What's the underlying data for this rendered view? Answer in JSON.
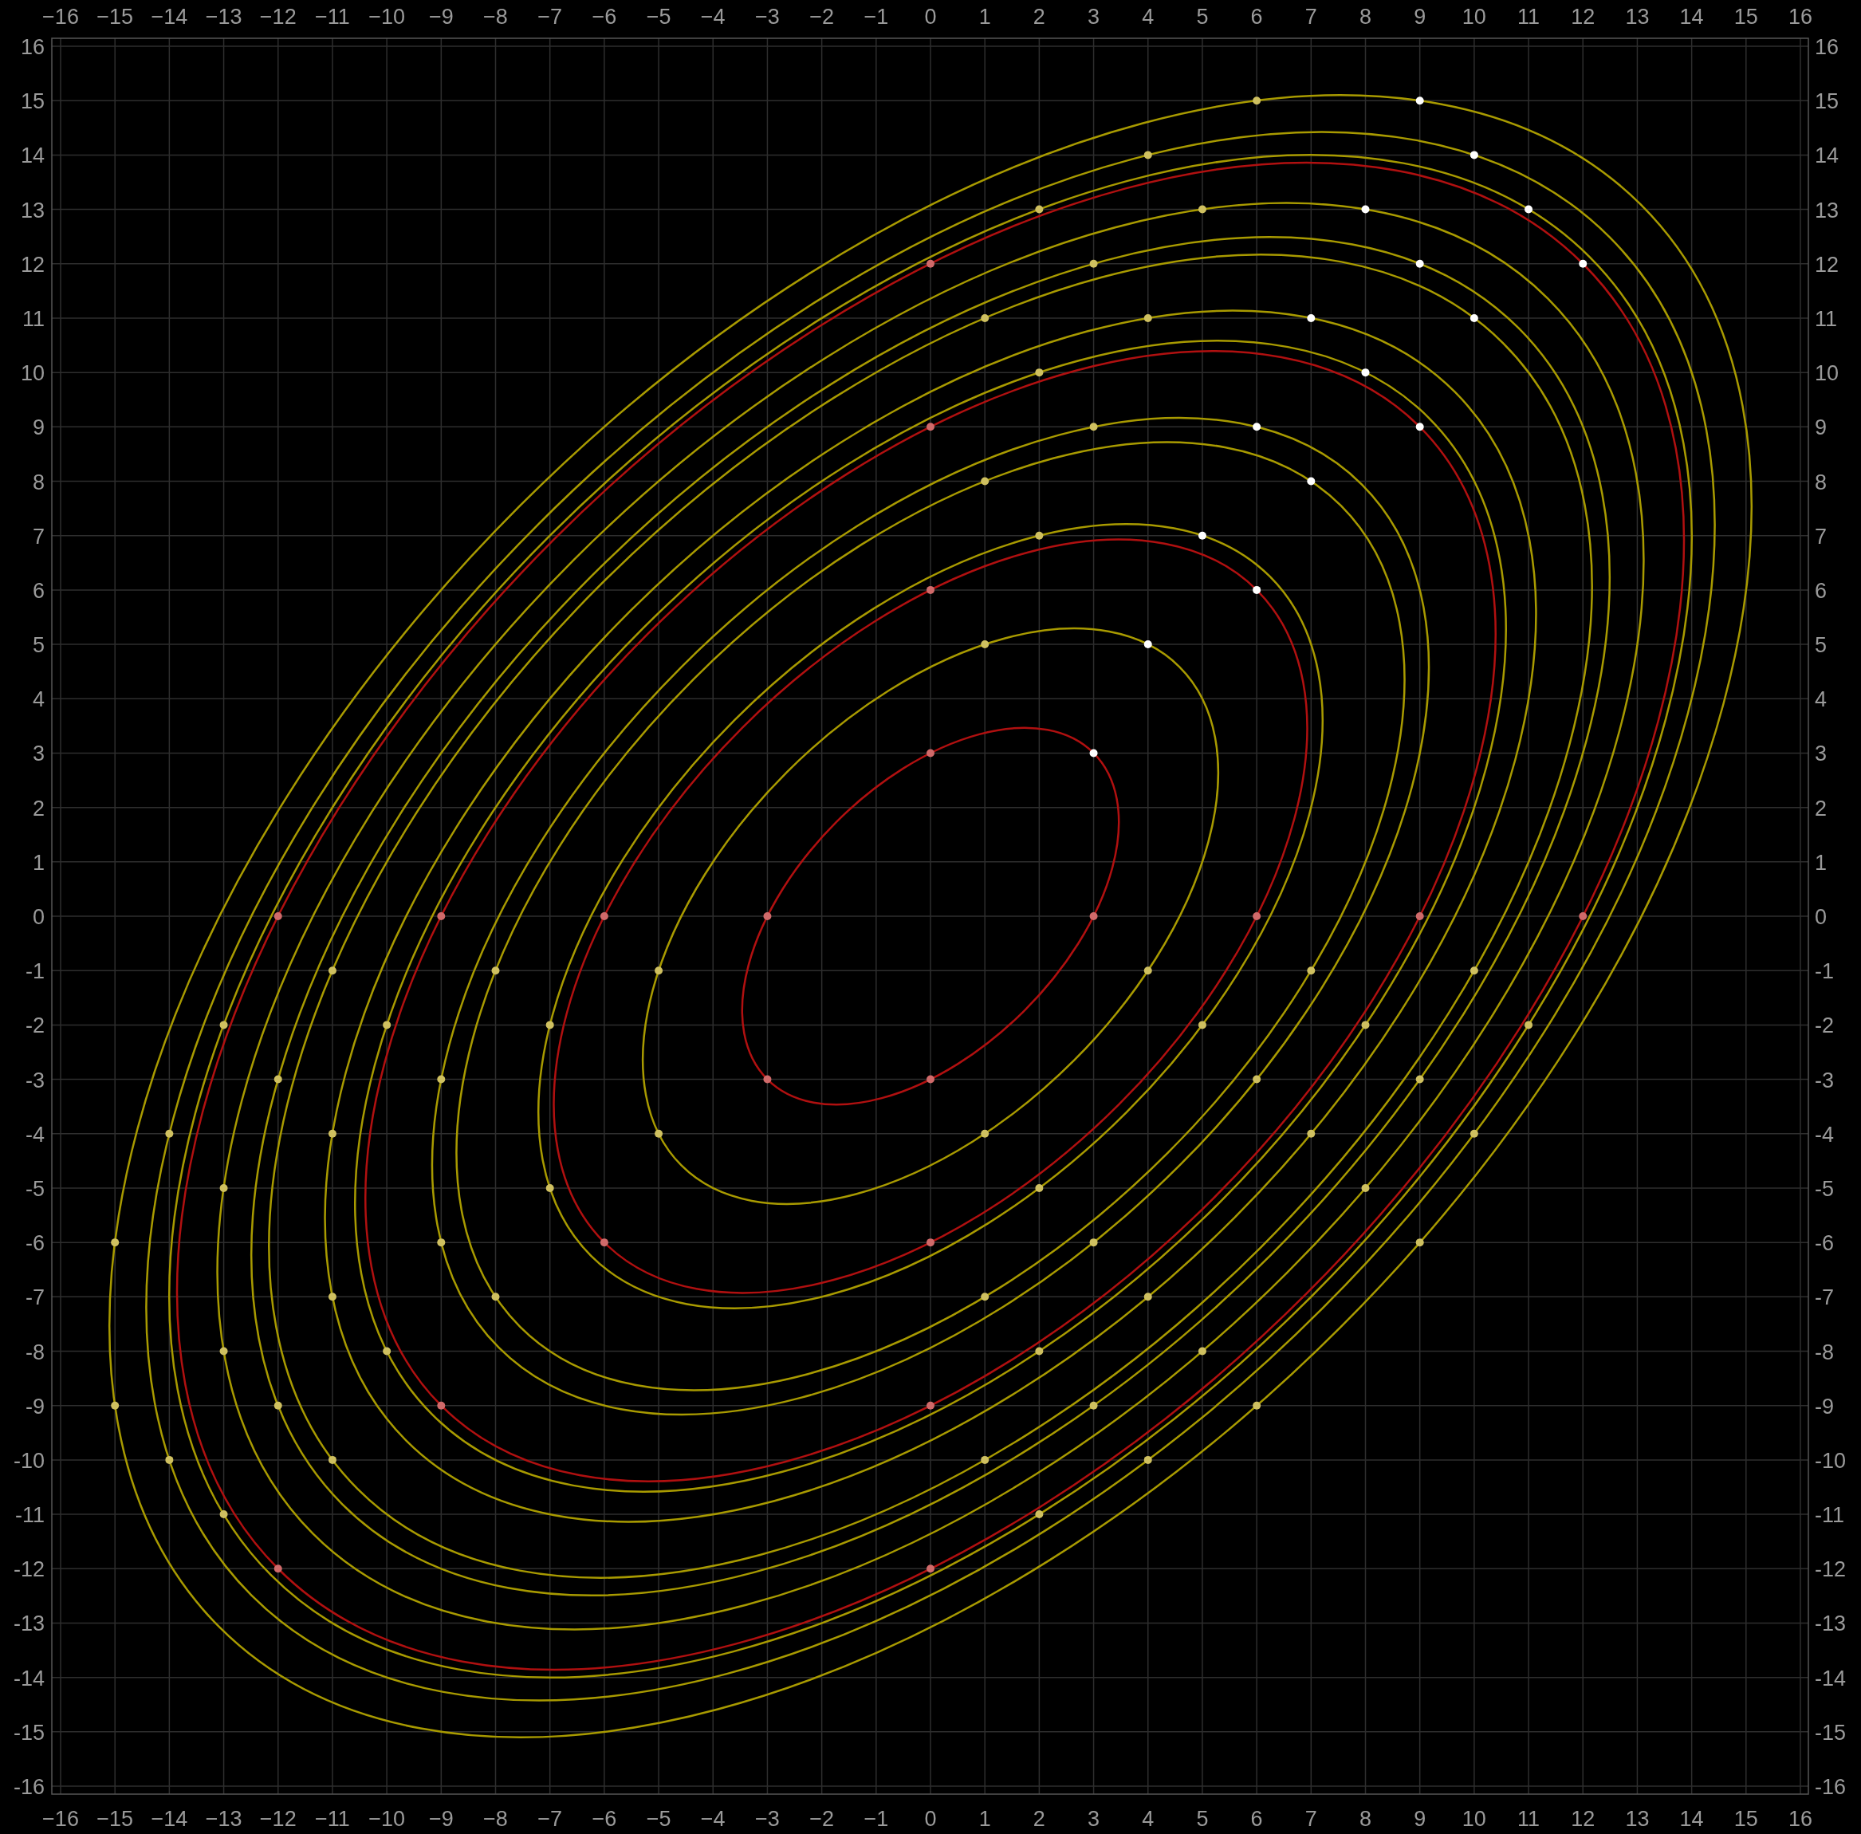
{
  "top_axis_labels": [
    "−16",
    "−15",
    "−14",
    "−13",
    "−12",
    "−11",
    "−10",
    "−9",
    "−8",
    "−7",
    "−6",
    "−5",
    "−4",
    "−3",
    "−2",
    "−1",
    "0",
    "1",
    "2",
    "3",
    "4",
    "5",
    "6",
    "7",
    "8",
    "9",
    "10",
    "11",
    "12",
    "13",
    "14",
    "15",
    "16"
  ],
  "right_axis_labels": [
    "16",
    "15",
    "14",
    "13",
    "12",
    "11",
    "10",
    "9",
    "8",
    "7",
    "6",
    "5",
    "4",
    "3",
    "2",
    "1",
    "0",
    "-1",
    "-2",
    "-3",
    "-4",
    "-5",
    "-6",
    "-7",
    "-8",
    "-9",
    "-10",
    "-11",
    "-12",
    "-13",
    "-14",
    "-15",
    "-16"
  ],
  "chart_data": {
    "type": "scatter",
    "grid": true,
    "xlim": [
      -16,
      16
    ],
    "ylim": [
      -16,
      16
    ],
    "xticks": [
      {
        "value": -16,
        "label": "−16"
      },
      {
        "value": -15,
        "label": "−15"
      },
      {
        "value": -14,
        "label": "−14"
      },
      {
        "value": -13,
        "label": "−13"
      },
      {
        "value": -12,
        "label": "−12"
      },
      {
        "value": -11,
        "label": "−11"
      },
      {
        "value": -10,
        "label": "−10"
      },
      {
        "value": -9,
        "label": "−9"
      },
      {
        "value": -8,
        "label": "−8"
      },
      {
        "value": -7,
        "label": "−7"
      },
      {
        "value": -6,
        "label": "−6"
      },
      {
        "value": -5,
        "label": "−5"
      },
      {
        "value": -4,
        "label": "−4"
      },
      {
        "value": -3,
        "label": "−3"
      },
      {
        "value": -2,
        "label": "−2"
      },
      {
        "value": -1,
        "label": "−1"
      },
      {
        "value": 0,
        "label": "0"
      },
      {
        "value": 1,
        "label": "1"
      },
      {
        "value": 2,
        "label": "2"
      },
      {
        "value": 3,
        "label": "3"
      },
      {
        "value": 4,
        "label": "4"
      },
      {
        "value": 5,
        "label": "5"
      },
      {
        "value": 6,
        "label": "6"
      },
      {
        "value": 7,
        "label": "7"
      },
      {
        "value": 8,
        "label": "8"
      },
      {
        "value": 9,
        "label": "9"
      },
      {
        "value": 10,
        "label": "10"
      },
      {
        "value": 11,
        "label": "11"
      },
      {
        "value": 12,
        "label": "12"
      },
      {
        "value": 13,
        "label": "13"
      },
      {
        "value": 14,
        "label": "14"
      },
      {
        "value": 15,
        "label": "15"
      },
      {
        "value": 16,
        "label": "16"
      }
    ],
    "yticks": [
      {
        "value": -16,
        "label": "-16"
      },
      {
        "value": -15,
        "label": "-15"
      },
      {
        "value": -14,
        "label": "-14"
      },
      {
        "value": -13,
        "label": "-13"
      },
      {
        "value": -12,
        "label": "-12"
      },
      {
        "value": -11,
        "label": "-11"
      },
      {
        "value": -10,
        "label": "-10"
      },
      {
        "value": -9,
        "label": "-9"
      },
      {
        "value": -8,
        "label": "-8"
      },
      {
        "value": -7,
        "label": "-7"
      },
      {
        "value": -6,
        "label": "-6"
      },
      {
        "value": -5,
        "label": "-5"
      },
      {
        "value": -4,
        "label": "-4"
      },
      {
        "value": -3,
        "label": "-3"
      },
      {
        "value": -2,
        "label": "-2"
      },
      {
        "value": -1,
        "label": "-1"
      },
      {
        "value": 0,
        "label": "0"
      },
      {
        "value": 1,
        "label": "1"
      },
      {
        "value": 2,
        "label": "2"
      },
      {
        "value": 3,
        "label": "3"
      },
      {
        "value": 4,
        "label": "4"
      },
      {
        "value": 5,
        "label": "5"
      },
      {
        "value": 6,
        "label": "6"
      },
      {
        "value": 7,
        "label": "7"
      },
      {
        "value": 8,
        "label": "8"
      },
      {
        "value": 9,
        "label": "9"
      },
      {
        "value": 10,
        "label": "10"
      },
      {
        "value": 11,
        "label": "11"
      },
      {
        "value": 12,
        "label": "12"
      },
      {
        "value": 13,
        "label": "13"
      },
      {
        "value": 14,
        "label": "14"
      },
      {
        "value": 15,
        "label": "15"
      },
      {
        "value": 16,
        "label": "16"
      }
    ],
    "x": [
      0,
      0,
      0,
      0,
      -12,
      -9,
      -6,
      -3,
      3,
      6,
      9,
      12,
      -3,
      0,
      -6,
      0,
      -9,
      0,
      -12,
      0,
      6,
      4,
      2,
      5,
      3,
      1,
      4,
      2,
      3,
      1,
      2,
      1,
      -11,
      -8,
      -5,
      4,
      7,
      10,
      -13,
      -10,
      -7,
      5,
      8,
      11,
      -12,
      -9,
      6,
      9,
      -14,
      -11,
      -5,
      1,
      7,
      10,
      -13,
      -7,
      2,
      8,
      -15,
      -9,
      3,
      9,
      -11,
      -8,
      1,
      4,
      -13,
      -10,
      2,
      5,
      -15,
      -12,
      3,
      6,
      -14,
      -11,
      1,
      4,
      -13,
      2,
      3,
      4,
      6,
      5,
      7,
      6,
      9,
      8,
      7,
      10,
      9,
      12,
      8,
      11,
      10,
      9
    ],
    "series": [
      {
        "color": "#d06a6a",
        "values": [
          3,
          6,
          9,
          12,
          0,
          0,
          0,
          0,
          0,
          0,
          0,
          0,
          -3,
          -3,
          -6,
          -6,
          -9,
          -9,
          -12,
          -12,
          null,
          null,
          null,
          null,
          null,
          null,
          null,
          null,
          null,
          null,
          null,
          null,
          null,
          null,
          null,
          null,
          null,
          null,
          null,
          null,
          null,
          null,
          null,
          null,
          null,
          null,
          null,
          null,
          null,
          null,
          null,
          null,
          null,
          null,
          null,
          null,
          null,
          null,
          null,
          null,
          null,
          null,
          null,
          null,
          null,
          null,
          null,
          null,
          null,
          null,
          null,
          null,
          null,
          null,
          null,
          null,
          null,
          null,
          null,
          null,
          null,
          null,
          null,
          null,
          null,
          null,
          null,
          null,
          null,
          null,
          null,
          null,
          null,
          null,
          null,
          null
        ]
      },
      {
        "color": "#cfc060",
        "values": [
          null,
          null,
          null,
          null,
          null,
          null,
          null,
          null,
          null,
          null,
          null,
          null,
          null,
          null,
          null,
          null,
          null,
          null,
          null,
          null,
          15,
          14,
          13,
          13,
          12,
          11,
          11,
          10,
          9,
          8,
          7,
          5,
          -1,
          -1,
          -1,
          -1,
          -1,
          -1,
          -2,
          -2,
          -2,
          -2,
          -2,
          -2,
          -3,
          -3,
          -3,
          -3,
          -4,
          -4,
          -4,
          -4,
          -4,
          -4,
          -5,
          -5,
          -5,
          -5,
          -6,
          -6,
          -6,
          -6,
          -7,
          -7,
          -7,
          -7,
          -8,
          -8,
          -8,
          -8,
          -9,
          -9,
          -9,
          -9,
          -10,
          -10,
          -10,
          -10,
          -11,
          -11,
          null,
          null,
          null,
          null,
          null,
          null,
          null,
          null,
          null,
          null,
          null,
          null,
          null,
          null,
          null,
          null
        ]
      },
      {
        "color": "#ffffff",
        "values": [
          null,
          null,
          null,
          null,
          null,
          null,
          null,
          null,
          null,
          null,
          null,
          null,
          null,
          null,
          null,
          null,
          null,
          null,
          null,
          null,
          null,
          null,
          null,
          null,
          null,
          null,
          null,
          null,
          null,
          null,
          null,
          null,
          null,
          null,
          null,
          null,
          null,
          null,
          null,
          null,
          null,
          null,
          null,
          null,
          null,
          null,
          null,
          null,
          null,
          null,
          null,
          null,
          null,
          null,
          null,
          null,
          null,
          null,
          null,
          null,
          null,
          null,
          null,
          null,
          null,
          null,
          null,
          null,
          null,
          null,
          null,
          null,
          null,
          null,
          null,
          null,
          null,
          null,
          null,
          null,
          3,
          5,
          6,
          7,
          8,
          9,
          9,
          10,
          11,
          11,
          12,
          12,
          13,
          13,
          14,
          15
        ]
      }
    ]
  }
}
